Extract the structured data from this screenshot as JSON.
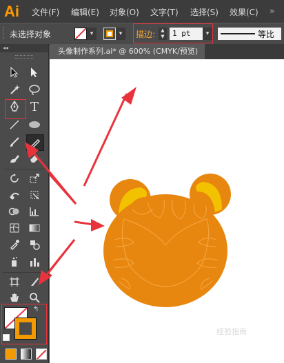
{
  "app": {
    "logo": "Ai"
  },
  "menu": [
    {
      "label": "文件(F)"
    },
    {
      "label": "编辑(E)"
    },
    {
      "label": "对象(O)"
    },
    {
      "label": "文字(T)"
    },
    {
      "label": "选择(S)"
    },
    {
      "label": "效果(C)"
    }
  ],
  "control": {
    "selection_status": "未选择对象",
    "stroke_label": "描边:",
    "stroke_weight": "1 pt",
    "profile_label": "等比"
  },
  "toolbox": {
    "collapse": "◂◂"
  },
  "tools": [
    {
      "name": "selection-tool",
      "icon": "selection-arrow-icon"
    },
    {
      "name": "direct-selection-tool",
      "icon": "direct-selection-icon"
    },
    {
      "name": "magic-wand-tool",
      "icon": "magic-wand-icon"
    },
    {
      "name": "lasso-tool",
      "icon": "lasso-icon"
    },
    {
      "name": "pen-tool",
      "icon": "pen-icon"
    },
    {
      "name": "type-tool",
      "icon": "type-icon",
      "glyph": "T"
    },
    {
      "name": "line-tool",
      "icon": "line-icon"
    },
    {
      "name": "ellipse-tool",
      "icon": "ellipse-icon"
    },
    {
      "name": "paintbrush-tool",
      "icon": "paintbrush-icon"
    },
    {
      "name": "pencil-tool",
      "icon": "pencil-icon"
    },
    {
      "name": "blob-brush-tool",
      "icon": "blob-brush-icon"
    },
    {
      "name": "eraser-tool",
      "icon": "eraser-icon"
    },
    {
      "name": "rotate-tool",
      "icon": "rotate-icon"
    },
    {
      "name": "scale-tool",
      "icon": "scale-icon"
    },
    {
      "name": "warp-tool",
      "icon": "warp-icon"
    },
    {
      "name": "free-transform-tool",
      "icon": "free-transform-icon"
    },
    {
      "name": "shape-builder-tool",
      "icon": "shape-builder-icon"
    },
    {
      "name": "graph-tool",
      "icon": "graph-icon"
    },
    {
      "name": "mesh-tool",
      "icon": "mesh-icon"
    },
    {
      "name": "gradient-tool",
      "icon": "gradient-icon"
    },
    {
      "name": "eyedropper-tool",
      "icon": "eyedropper-icon"
    },
    {
      "name": "blend-tool",
      "icon": "blend-icon"
    },
    {
      "name": "symbol-sprayer-tool",
      "icon": "symbol-sprayer-icon"
    },
    {
      "name": "column-graph-tool",
      "icon": "column-graph-icon"
    },
    {
      "name": "artboard-tool",
      "icon": "artboard-icon"
    },
    {
      "name": "slice-tool",
      "icon": "slice-icon"
    },
    {
      "name": "hand-tool",
      "icon": "hand-icon"
    },
    {
      "name": "zoom-tool",
      "icon": "zoom-icon"
    }
  ],
  "document": {
    "tab_title": "头像制作系列.ai* @ 600% (CMYK/预览)"
  },
  "colors": {
    "face": "#e8870f",
    "ear_inner": "#f2c200",
    "stripe": "#f4a23a",
    "arrow": "#e8333c",
    "highlight_box": "#e8333c",
    "stroke_swatch": "#f29a00"
  },
  "watermark": "经验指南"
}
